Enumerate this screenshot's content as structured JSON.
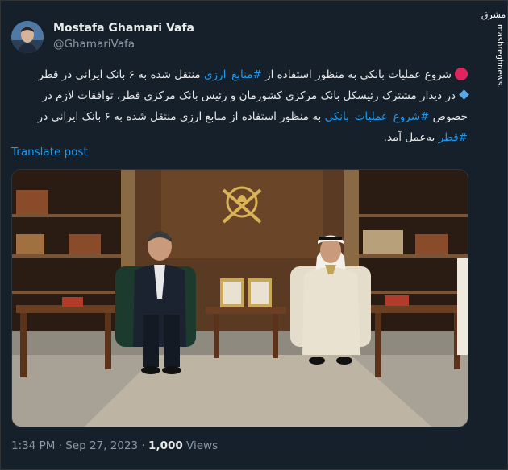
{
  "author": {
    "name": "Mostafa Ghamari Vafa",
    "handle": "@GhamariVafa"
  },
  "watermark": {
    "brand": "مشرق",
    "site": "mashreghnews.ir"
  },
  "tweet": {
    "line1_pre": "شروع عملیات بانکی به منظور استفاده از",
    "line1_hash": "#منابع_ارزی",
    "line1_post": "منتقل شده به ۶ بانک ایرانی در قطر",
    "line2": "در دیدار مشترک رئیسکل بانک مرکزی کشورمان و رئیس بانک مرکزی قطر، توافقات لازم در",
    "line3_pre": "خصوص",
    "line3_hash": "#شروع_عملیات_بانکی",
    "line3_post": "به منظور استفاده از منابع ارزی منتقل شده به ۶ بانک ایرانی در",
    "line4_hash": "#قطر",
    "line4_post": "به‌عمل آمد."
  },
  "translate_label": "Translate post",
  "meta": {
    "time": "1:34 PM",
    "sep": "·",
    "date": "Sep 27, 2023",
    "views_count": "1,000",
    "views_label": "Views"
  },
  "colors": {
    "background": "#15202b",
    "link": "#1d9bf0",
    "muted": "#8b98a5",
    "text": "#e7e9ea"
  }
}
